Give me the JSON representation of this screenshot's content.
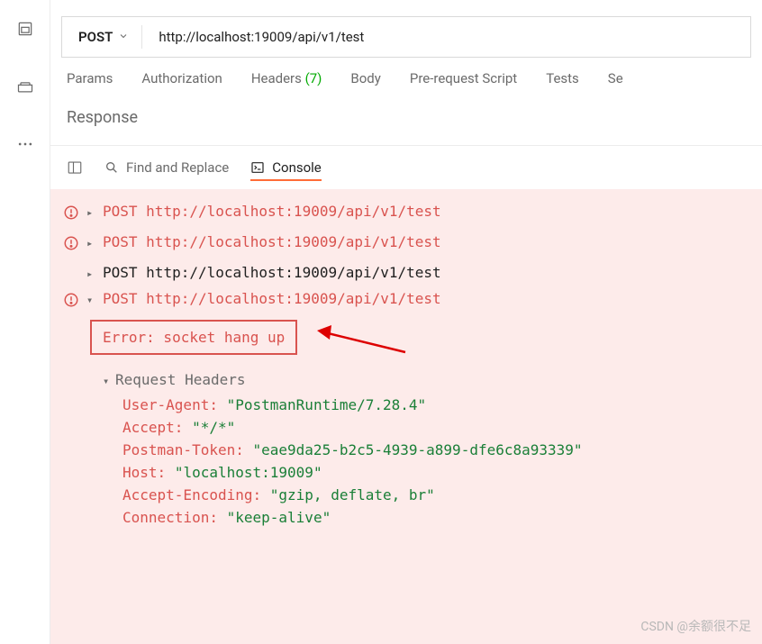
{
  "rail": {
    "icons": [
      "collections",
      "cookies",
      "more"
    ]
  },
  "request": {
    "method": "POST",
    "url": "http://localhost:19009/api/v1/test"
  },
  "tabs": [
    {
      "label": "Params"
    },
    {
      "label": "Authorization"
    },
    {
      "label": "Headers",
      "count": "(7)"
    },
    {
      "label": "Body"
    },
    {
      "label": "Pre-request Script"
    },
    {
      "label": "Tests"
    },
    {
      "label": "Se"
    }
  ],
  "response_label": "Response",
  "bottom": {
    "find_replace": "Find and Replace",
    "console": "Console"
  },
  "logs": [
    {
      "warn": true,
      "caret": "▸",
      "method": "POST",
      "url": "http://localhost:19009/api/v1/test",
      "color": "red"
    },
    {
      "warn": true,
      "caret": "▸",
      "method": "POST",
      "url": "http://localhost:19009/api/v1/test",
      "color": "red"
    },
    {
      "warn": false,
      "caret": "▸",
      "method": "POST",
      "url": "http://localhost:19009/api/v1/test",
      "color": "black"
    },
    {
      "warn": true,
      "caret": "▾",
      "method": "POST",
      "url": "http://localhost:19009/api/v1/test",
      "color": "red",
      "expanded": true
    }
  ],
  "error_text": "Error: socket hang up",
  "headers_label": "Request Headers",
  "headers": [
    {
      "key": "User-Agent:",
      "val": "\"PostmanRuntime/7.28.4\""
    },
    {
      "key": "Accept:",
      "val": "\"*/*\""
    },
    {
      "key": "Postman-Token:",
      "val": "\"eae9da25-b2c5-4939-a899-dfe6c8a93339\""
    },
    {
      "key": "Host:",
      "val": "\"localhost:19009\""
    },
    {
      "key": "Accept-Encoding:",
      "val": "\"gzip, deflate, br\""
    },
    {
      "key": "Connection:",
      "val": "\"keep-alive\""
    }
  ],
  "watermark": "CSDN @余额很不足"
}
